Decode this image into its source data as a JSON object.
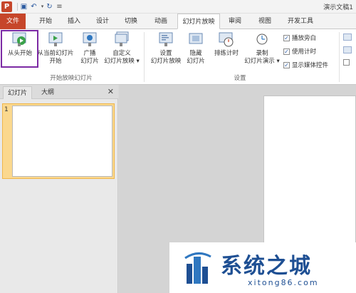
{
  "titlebar": {
    "app_icon": "P",
    "window_title": "演示文稿1"
  },
  "tabs": [
    "文件",
    "开始",
    "插入",
    "设计",
    "切换",
    "动画",
    "幻灯片放映",
    "审阅",
    "视图",
    "开发工具"
  ],
  "ribbon": {
    "group_start": {
      "label": "开始放映幻灯片",
      "from_start": "从头开始",
      "from_current_line1": "从当前幻灯片",
      "from_current_line2": "开始",
      "broadcast_line1": "广播",
      "broadcast_line2": "幻灯片",
      "custom_line1": "自定义",
      "custom_line2": "幻灯片放映"
    },
    "group_setup": {
      "label": "设置",
      "setup_line1": "设置",
      "setup_line2": "幻灯片放映",
      "hide_line1": "隐藏",
      "hide_line2": "幻灯片",
      "rehearse": "排练计时",
      "record_line1": "录制",
      "record_line2": "幻灯片演示",
      "chk_narration": "播放旁白",
      "chk_timing": "使用计时",
      "chk_media": "显示媒体控件"
    }
  },
  "panel": {
    "tab_slides": "幻灯片",
    "tab_outline": "大纲",
    "close": "✕",
    "slide_number": "1"
  },
  "watermark": {
    "text": "系统之城",
    "url": "xitong86.com"
  }
}
